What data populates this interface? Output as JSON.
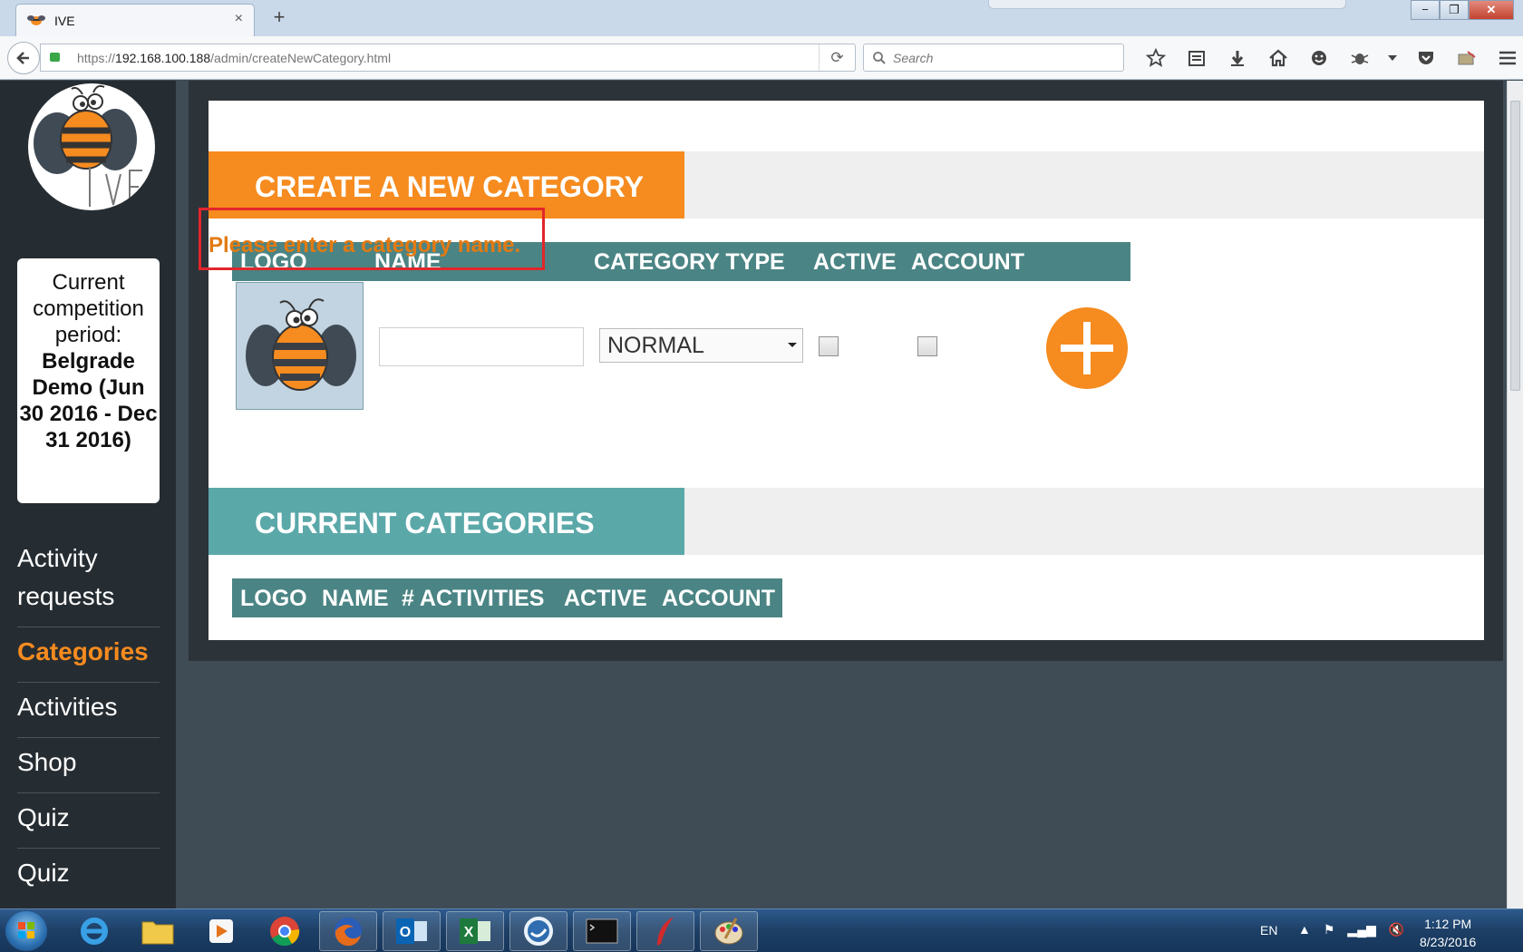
{
  "browser": {
    "tab_title": "IVE",
    "tab_close": "×",
    "new_tab": "+",
    "url_prefix": "https://",
    "url_host": "192.168.100.188",
    "url_path": "/admin/createNewCategory.html",
    "search_placeholder": "Search",
    "reload": "⟳",
    "window_controls": [
      "−",
      "❐",
      "✕"
    ]
  },
  "sidebar": {
    "period_label": "Current competition period:",
    "period_name": "Belgrade Demo (Jun 30 2016 - Dec 31 2016)",
    "nav": [
      {
        "label": "Activity requests",
        "active": false
      },
      {
        "label": "Categories",
        "active": true
      },
      {
        "label": "Activities",
        "active": false
      },
      {
        "label": "Shop",
        "active": false
      },
      {
        "label": "Quiz",
        "active": false
      },
      {
        "label": "Quiz",
        "active": false
      }
    ]
  },
  "create_section": {
    "title": "CREATE A NEW CATEGORY",
    "error": "Please enter a category name.",
    "columns": [
      "LOGO",
      "NAME",
      "CATEGORY TYPE",
      "ACTIVE",
      "ACCOUNT"
    ],
    "name_value": "",
    "category_type": "NORMAL",
    "active_checked": false,
    "account_checked": false
  },
  "current_section": {
    "title": "CURRENT CATEGORIES",
    "columns": [
      "LOGO",
      "NAME",
      "# ACTIVITIES",
      "ACTIVE",
      "ACCOUNT"
    ]
  },
  "taskbar": {
    "apps": [
      "internet-explorer",
      "file-explorer",
      "media-player",
      "chrome",
      "firefox",
      "outlook",
      "excel",
      "communicator",
      "command-prompt",
      "pen-app",
      "paint"
    ],
    "language": "EN",
    "time": "1:12 PM",
    "date": "8/23/2016"
  },
  "colors": {
    "accent_orange": "#f68b1f",
    "teal_header": "#4b8484",
    "teal_band": "#5ba8a9",
    "error_text": "#e27a12",
    "highlight_box": "#e2262b",
    "sidebar_bg": "#262d32"
  }
}
